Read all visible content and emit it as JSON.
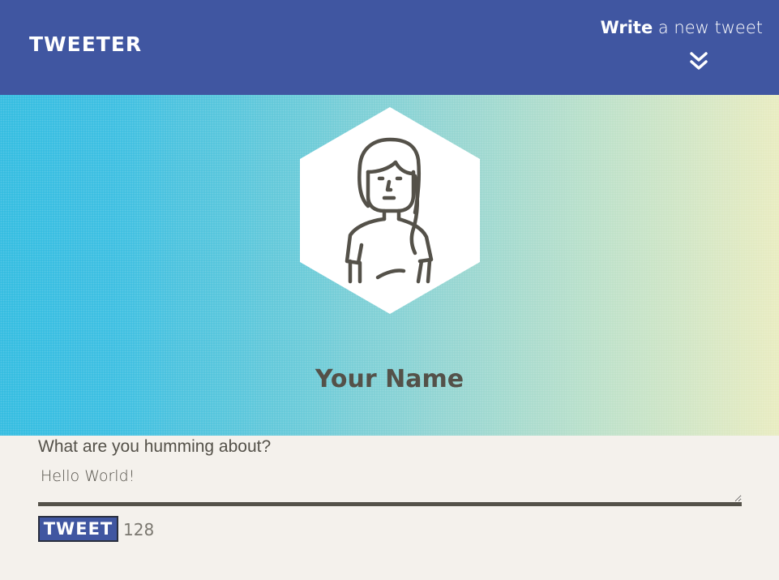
{
  "nav": {
    "logo": "TWEETER",
    "compose_bold": "Write",
    "compose_rest": " a new tweet",
    "compose_icon": "double-chevron-down-icon"
  },
  "profile": {
    "name": "Your Name",
    "avatar_icon": "woman-avatar-icon"
  },
  "compose": {
    "prompt": "What are you humming about?",
    "text": "Hello World!",
    "button_label": "TWEET",
    "char_counter": "128"
  },
  "colors": {
    "nav_bg": "#4056a1",
    "page_bg": "#f4f1ec",
    "text_dark": "#545149",
    "banner_left": "#2fbbe0",
    "banner_right": "#e8ebbf"
  }
}
